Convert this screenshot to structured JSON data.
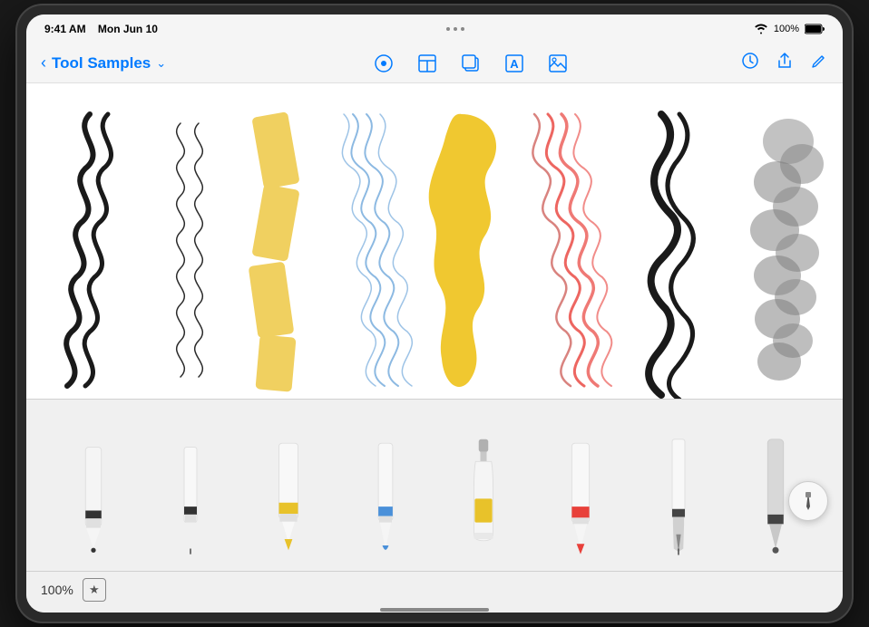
{
  "statusBar": {
    "time": "9:41 AM",
    "date": "Mon Jun 10",
    "wifi": "📶",
    "batteryPct": "100%"
  },
  "navBar": {
    "backLabel": "‹",
    "title": "Tool Samples",
    "chevron": "⌄",
    "tools": [
      {
        "name": "pen-nib-icon",
        "symbol": "◎"
      },
      {
        "name": "layout-icon",
        "symbol": "⬛"
      },
      {
        "name": "copy-icon",
        "symbol": "⧉"
      },
      {
        "name": "text-icon",
        "symbol": "A"
      },
      {
        "name": "image-icon",
        "symbol": "⬜"
      }
    ],
    "rightButtons": [
      {
        "name": "clock-icon",
        "symbol": "⏱"
      },
      {
        "name": "share-icon",
        "symbol": "⬆"
      },
      {
        "name": "edit-icon",
        "symbol": "✎"
      }
    ]
  },
  "bottomBar": {
    "zoomLevel": "100%",
    "starLabel": "★"
  },
  "tools": [
    {
      "name": "pencil",
      "color": "#333",
      "accentColor": "#333"
    },
    {
      "name": "fineliner",
      "color": "#444",
      "accentColor": "#444"
    },
    {
      "name": "marker",
      "color": "#e8c22a",
      "accentColor": "#e8c22a"
    },
    {
      "name": "brush",
      "color": "#4a90d9",
      "accentColor": "#4a90d9"
    },
    {
      "name": "paint",
      "color": "#f5f5f5",
      "accentColor": "#e8c22a"
    },
    {
      "name": "crayon",
      "color": "#e8403a",
      "accentColor": "#e8403a"
    },
    {
      "name": "calligraphy",
      "color": "#333",
      "accentColor": "#333"
    },
    {
      "name": "airbrush",
      "color": "#555",
      "accentColor": "#555"
    }
  ]
}
